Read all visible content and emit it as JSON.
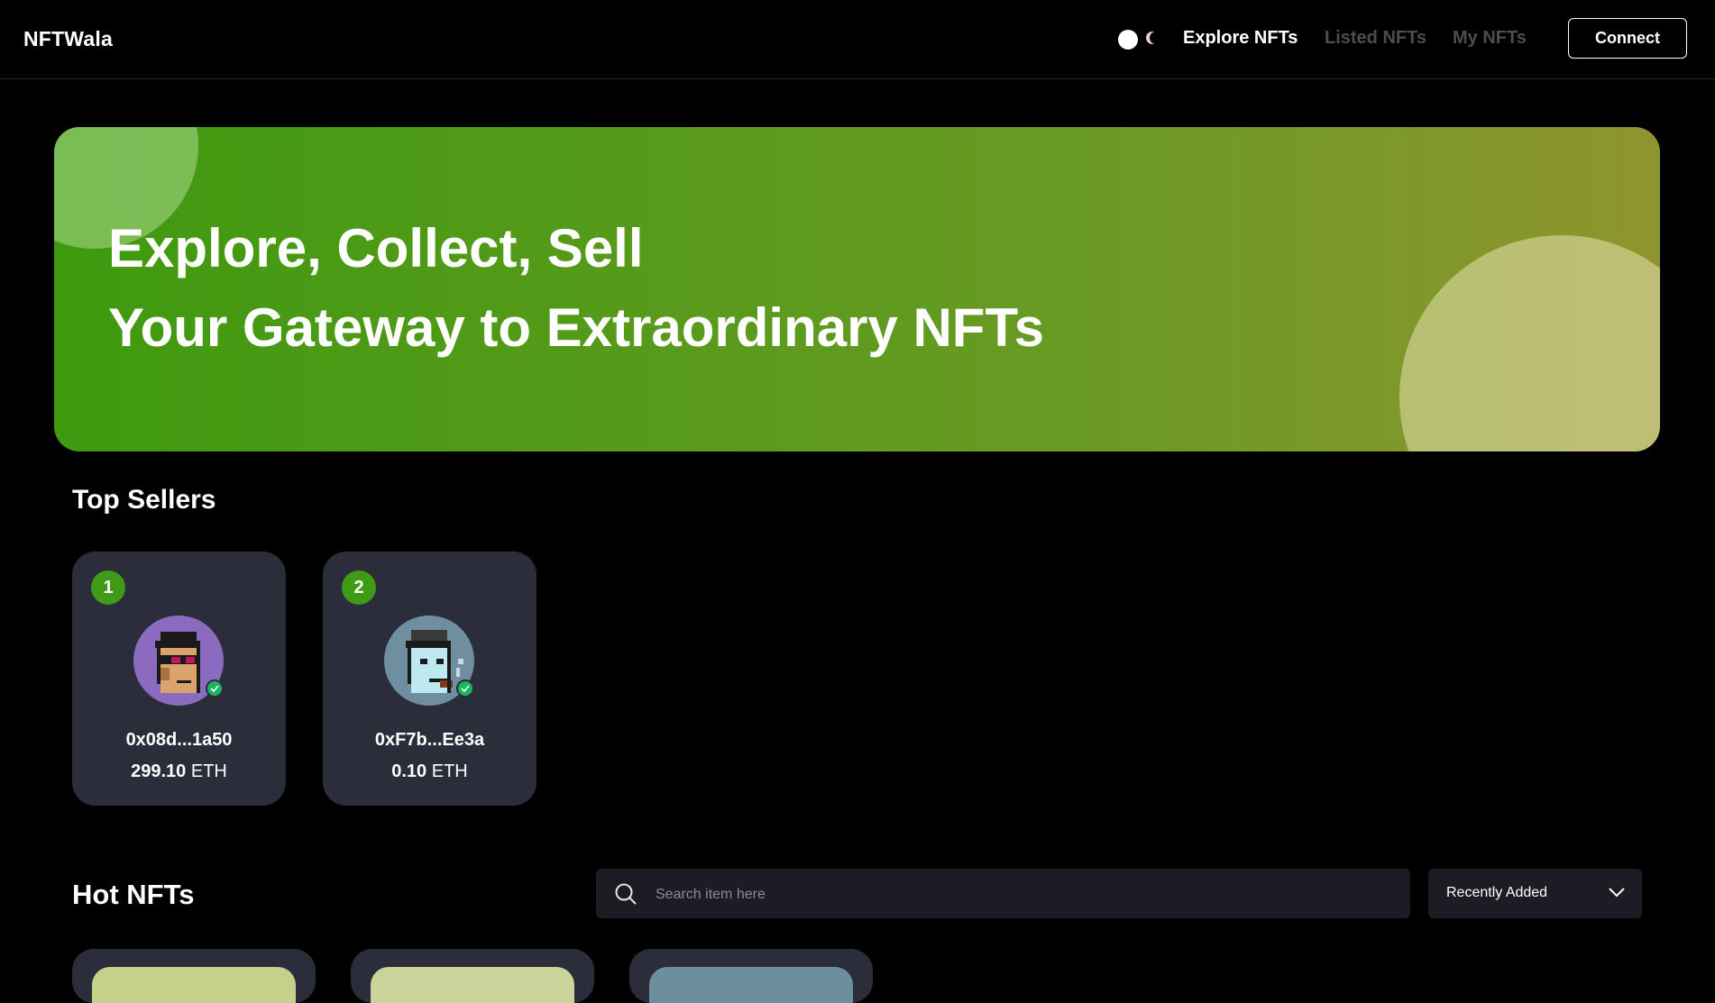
{
  "nav": {
    "brand": "NFTWala",
    "links": [
      {
        "label": "Explore NFTs",
        "active": true
      },
      {
        "label": "Listed NFTs",
        "active": false
      },
      {
        "label": "My NFTs",
        "active": false
      }
    ],
    "connect_label": "Connect",
    "theme_icons": [
      "sun-icon",
      "moon-icon"
    ]
  },
  "hero": {
    "line1": "Explore, Collect, Sell",
    "line2": "Your Gateway to Extraordinary NFTs",
    "gradient": [
      "#3e9a0f",
      "#8f952e"
    ]
  },
  "top_sellers": {
    "title": "Top Sellers",
    "sellers": [
      {
        "rank": "1",
        "address": "0x08d...1a50",
        "amount": "299.10",
        "unit": "ETH",
        "avatar_bg": "#8a6bbf"
      },
      {
        "rank": "2",
        "address": "0xF7b...Ee3a",
        "amount": "0.10",
        "unit": "ETH",
        "avatar_bg": "#6f8fa0"
      }
    ]
  },
  "hot_nfts": {
    "title": "Hot NFTs",
    "search_placeholder": "Search item here",
    "sort_selected": "Recently Added"
  },
  "colors": {
    "accent_green": "#3f9a16",
    "card_bg": "#2b2d3a",
    "input_bg": "#1c1d24",
    "verified": "#1bb562"
  }
}
